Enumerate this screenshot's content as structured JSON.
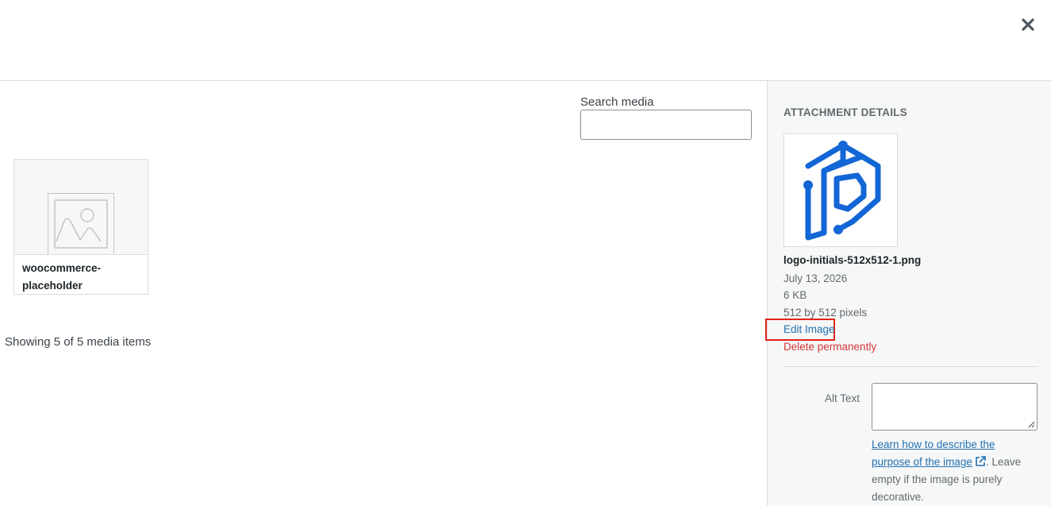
{
  "header": {
    "close_label": "×"
  },
  "browser": {
    "search_label": "Search media",
    "search_value": "",
    "items": [
      {
        "title": "woocommerce-placeholder",
        "caption_line1": "woocommerce-",
        "caption_line2": "placeholder"
      }
    ],
    "showing_text": "Showing 5 of 5 media items"
  },
  "sidebar": {
    "title": "ATTACHMENT DETAILS",
    "filename": "logo-initials-512x512-1.png",
    "date": "July 13, 2026",
    "size": "6 KB",
    "dimensions": "512 by 512 pixels",
    "edit_label": "Edit Image",
    "delete_label": "Delete permanently",
    "alt_label": "Alt Text",
    "alt_value": "",
    "help_link_text": "Learn how to describe the purpose of the image",
    "help_suffix": ". Leave empty if the image is purely decorative."
  },
  "colors": {
    "link": "#2271b1",
    "delete": "#d63638",
    "highlight": "#e0251b",
    "logo": "#1366d6"
  },
  "icons": {
    "close": "close-icon",
    "placeholder": "image-placeholder-icon",
    "external": "external-link-icon"
  }
}
